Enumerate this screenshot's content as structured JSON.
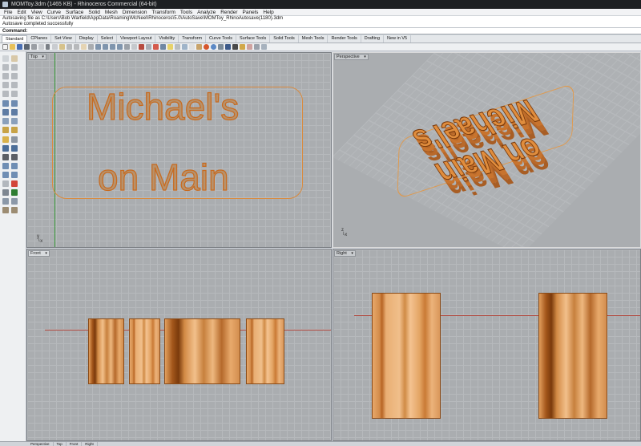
{
  "window": {
    "title": "MOMToy.3dm (1465 KB) - Rhinoceros Commercial (64-bit)"
  },
  "menu": [
    "File",
    "Edit",
    "View",
    "Curve",
    "Surface",
    "Solid",
    "Mesh",
    "Dimension",
    "Transform",
    "Tools",
    "Analyze",
    "Render",
    "Panels",
    "Help"
  ],
  "history": [
    "Autosaving file as C:\\Users\\Bob Warfield\\AppData\\Roaming\\McNeel\\Rhinoceros\\5.0\\AutoSave\\MOMToy_RhinoAutosave(1180).3dm",
    "Autosave completed successfully"
  ],
  "command": {
    "label": "Command:"
  },
  "tabs": [
    "Standard",
    "CPlanes",
    "Set View",
    "Display",
    "Select",
    "Viewport Layout",
    "Visibility",
    "Transform",
    "Curve Tools",
    "Surface Tools",
    "Solid Tools",
    "Mesh Tools",
    "Render Tools",
    "Drafting",
    "New in V5"
  ],
  "active_tab": "Standard",
  "viewports": {
    "top": {
      "label": "Top",
      "line1": "Michael's",
      "line2": "on Main"
    },
    "perspective": {
      "label": "Perspective",
      "line1": "Michael's",
      "line2": "on Main"
    },
    "front": {
      "label": "Front"
    },
    "right": {
      "label": "Right"
    }
  },
  "viewport_tabs": [
    "Perspective",
    "Top",
    "Front",
    "Right"
  ],
  "colors": {
    "object": "#d98a3d",
    "object_edge": "#c86a1e",
    "grid": "#aaadb0",
    "x_axis": "#b0443a",
    "y_axis": "#3a9a3a"
  }
}
